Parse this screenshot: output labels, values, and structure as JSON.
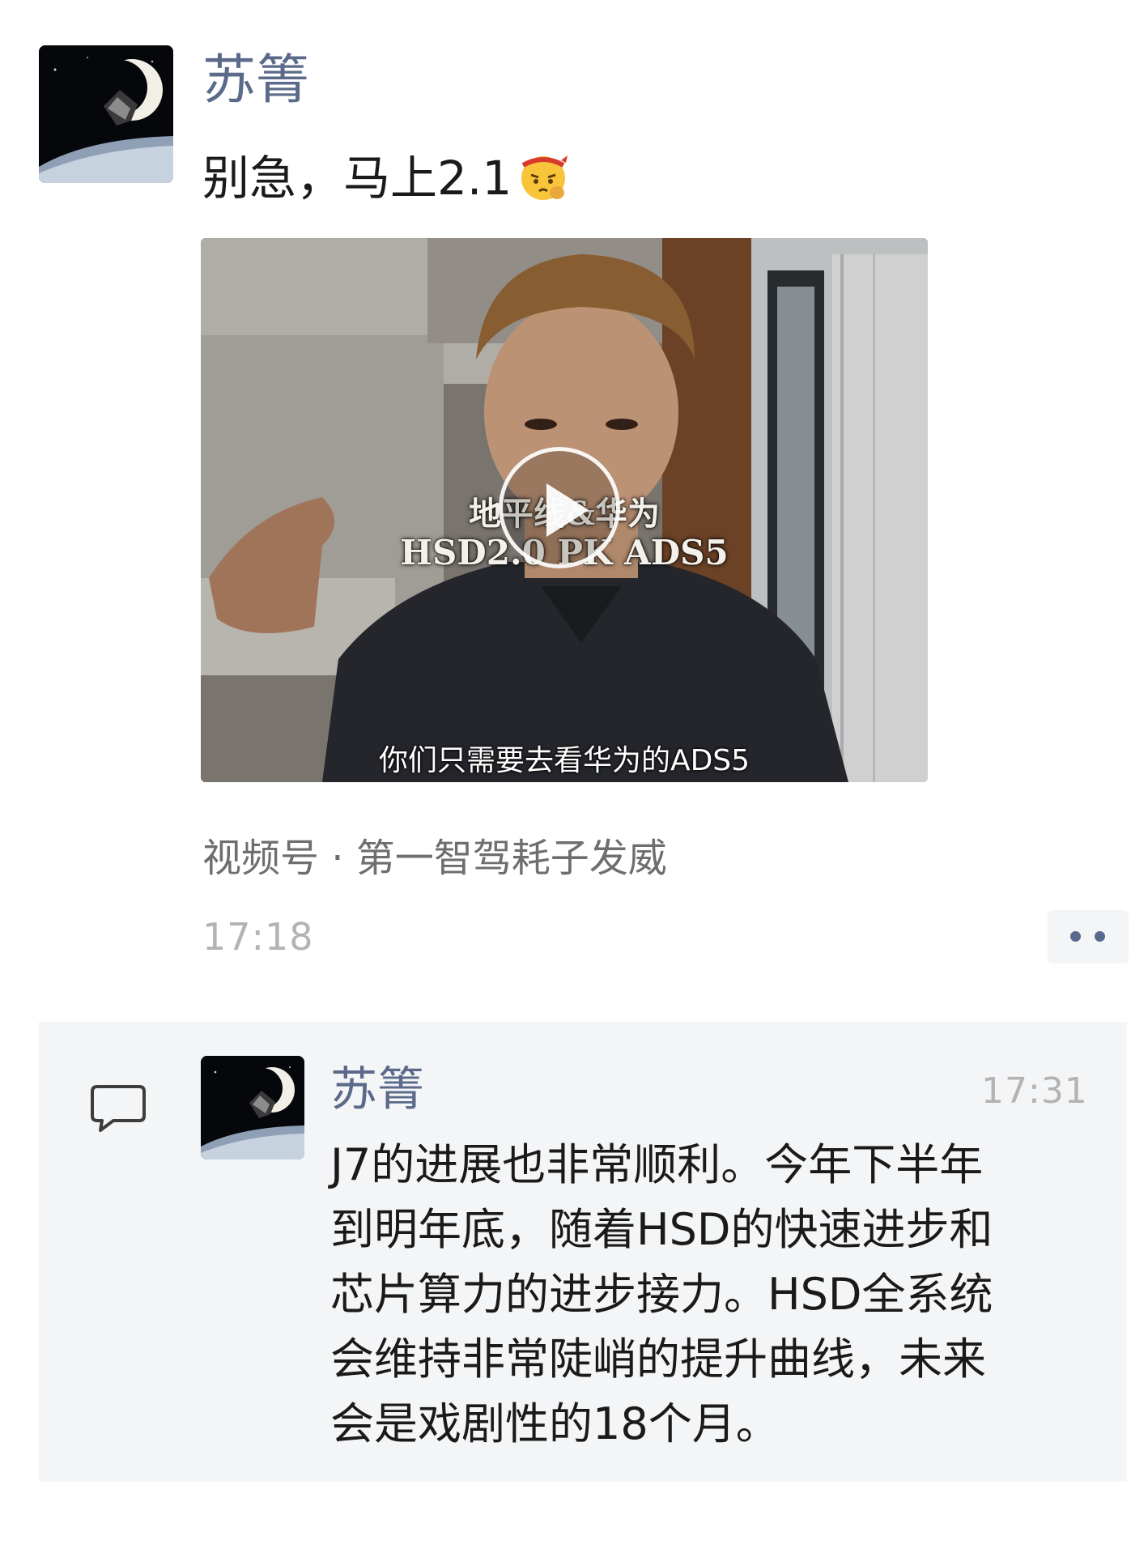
{
  "post": {
    "author": "苏箐",
    "text": "别急，马上2.1",
    "emoji": "salute-face-emoji",
    "video": {
      "title_line1": "地平线&华为",
      "title_line2": "HSD2.0 PK ADS5",
      "subtitle": "你们只需要去看华为的ADS5"
    },
    "source": "视频号 · 第一智驾耗子发威",
    "timestamp": "17:18"
  },
  "comment": {
    "author": "苏箐",
    "timestamp": "17:31",
    "lines": [
      "J7的进展也非常顺利。今年下半年",
      "到明年底，随着HSD的快速进步和",
      "芯片算力的进步接力。HSD全系统",
      "会维持非常陡峭的提升曲线，未来",
      "会是戏剧性的18个月。"
    ]
  },
  "icons": {
    "comment": "comment-bubble-icon",
    "more": "more-dots-icon",
    "play": "play-icon"
  },
  "colors": {
    "name_link": "#5b6a8a",
    "timestamp": "#b3b3b3",
    "comment_bg": "#f4f5f7"
  }
}
